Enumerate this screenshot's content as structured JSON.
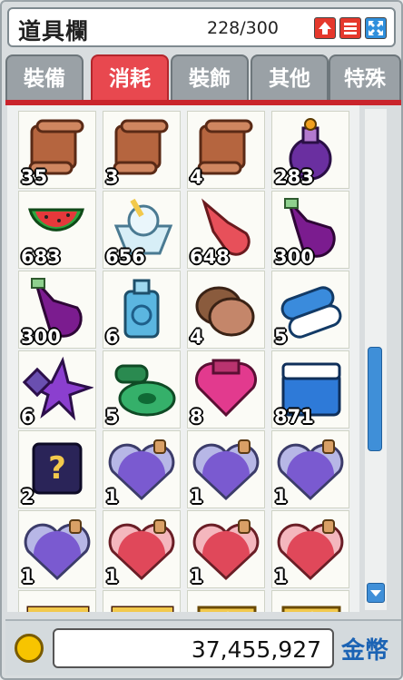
{
  "window": {
    "title": "道具欄",
    "capacity": "228/300"
  },
  "title_buttons": [
    {
      "name": "sort-up-button",
      "icon": "up-arrow-icon"
    },
    {
      "name": "menu-button",
      "icon": "menu-icon"
    },
    {
      "name": "expand-button",
      "icon": "expand-icon"
    }
  ],
  "tabs": [
    {
      "label": "裝備",
      "active": false
    },
    {
      "label": "消耗",
      "active": true
    },
    {
      "label": "裝飾",
      "active": false
    },
    {
      "label": "其他",
      "active": false
    },
    {
      "label": "特殊",
      "active": false
    }
  ],
  "items": [
    {
      "icon": "scroll",
      "qty": "35"
    },
    {
      "icon": "scroll",
      "qty": "3"
    },
    {
      "icon": "scroll",
      "qty": "4"
    },
    {
      "icon": "potion-bottle",
      "qty": "283"
    },
    {
      "icon": "watermelon",
      "qty": "683"
    },
    {
      "icon": "ice-cream",
      "qty": "656"
    },
    {
      "icon": "red-potion",
      "qty": "648"
    },
    {
      "icon": "purple-potion",
      "qty": "300"
    },
    {
      "icon": "purple-potion",
      "qty": "300"
    },
    {
      "icon": "blue-bottle",
      "qty": "6"
    },
    {
      "icon": "stone",
      "qty": "4"
    },
    {
      "icon": "pill",
      "qty": "5"
    },
    {
      "icon": "star-crystal",
      "qty": "6"
    },
    {
      "icon": "green-disc",
      "qty": "5"
    },
    {
      "icon": "pink-heart",
      "qty": "8"
    },
    {
      "icon": "cooler-box",
      "qty": "871"
    },
    {
      "icon": "mystery-scroll",
      "qty": "2"
    },
    {
      "icon": "purple-heart-flask",
      "qty": "1"
    },
    {
      "icon": "purple-heart-flask",
      "qty": "1"
    },
    {
      "icon": "purple-heart-flask",
      "qty": "1"
    },
    {
      "icon": "purple-heart-flask",
      "qty": "1"
    },
    {
      "icon": "red-heart-flask",
      "qty": "1"
    },
    {
      "icon": "red-heart-flask",
      "qty": "1"
    },
    {
      "icon": "red-heart-flask",
      "qty": "1"
    },
    {
      "icon": "book",
      "qty": ""
    },
    {
      "icon": "book",
      "qty": ""
    },
    {
      "icon": "gold-scroll",
      "qty": ""
    },
    {
      "icon": "gold-scroll",
      "qty": ""
    }
  ],
  "money": {
    "amount": "37,455,927",
    "currency_label": "金幣"
  }
}
